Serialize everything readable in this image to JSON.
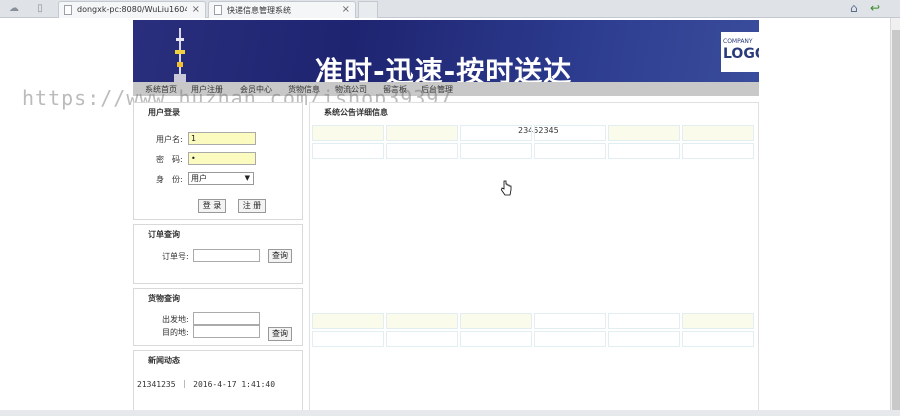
{
  "browser": {
    "tabs": [
      {
        "title": "dongxk-pc:8080/WuLiu1604/"
      },
      {
        "title": "快递信息管理系统"
      }
    ]
  },
  "banner": {
    "slogan": "准时-迅速-按时送达",
    "logo_small": "COMPANY",
    "logo_large": "LOGO"
  },
  "nav": {
    "items": [
      "系统首页",
      "用户注册",
      "会员中心",
      "货物信息",
      "物流公司",
      "留言板",
      "后台管理"
    ]
  },
  "watermark": "https://www.huzhan.com/ishop39397",
  "login": {
    "title": "用户登录",
    "username_label": "用户名:",
    "username_value": "1",
    "password_label": "密　码:",
    "password_value": "•",
    "role_label": "身　份:",
    "role_value": "用户",
    "login_button": "登 录",
    "register_button": "注 册"
  },
  "order_query": {
    "title": "订单查询",
    "order_label": "订单号:",
    "query_button": "查询"
  },
  "goods_query": {
    "title": "货物查询",
    "from_label": "出发地:",
    "to_label": "目的地:",
    "query_button": "查询"
  },
  "news": {
    "title": "新闻动态",
    "item": "21341235 ｜ 2016-4-17 1:41:40"
  },
  "main": {
    "title": "系统公告详细信息",
    "content": "23452345"
  }
}
